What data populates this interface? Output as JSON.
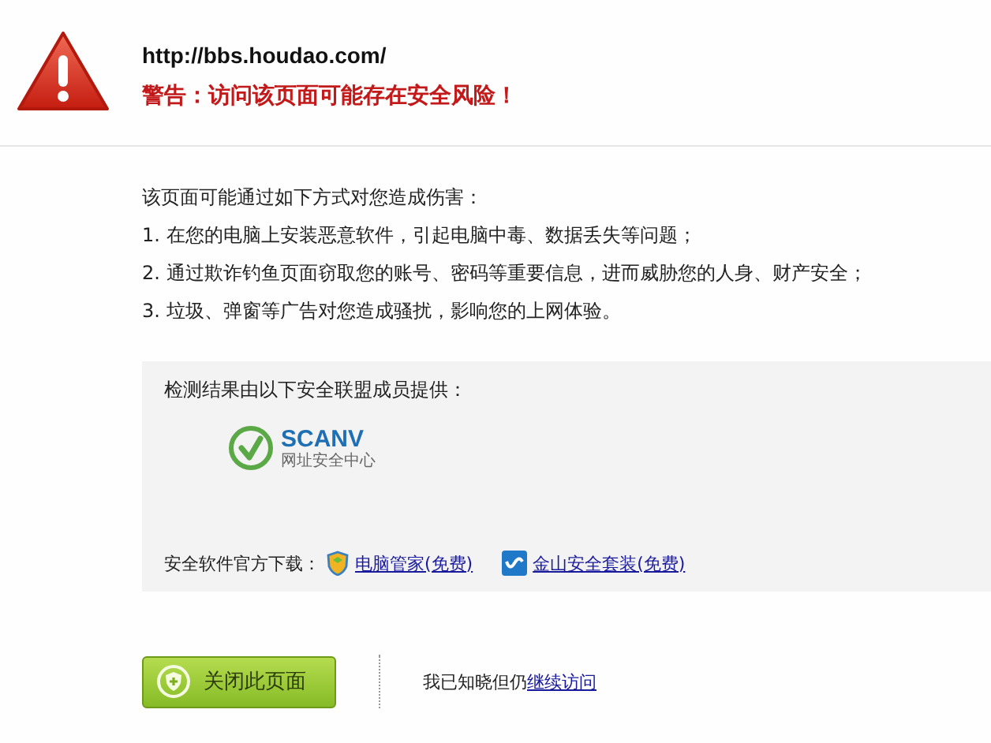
{
  "header": {
    "url": "http://bbs.houdao.com/",
    "warning": "警告：访问该页面可能存在安全风险！"
  },
  "risks": {
    "intro": "该页面可能通过如下方式对您造成伤害：",
    "items": [
      "1. 在您的电脑上安装恶意软件，引起电脑中毒、数据丢失等问题；",
      "2. 通过欺诈钓鱼页面窃取您的账号、密码等重要信息，进而威胁您的人身、财产安全；",
      "3. 垃圾、弹窗等广告对您造成骚扰，影响您的上网体验。"
    ]
  },
  "provider": {
    "caption": "检测结果由以下安全联盟成员提供：",
    "logo_name": "SCANV",
    "logo_subtitle": "网址安全中心",
    "download_label": "安全软件官方下载：",
    "downloads": [
      {
        "kind": "shield",
        "label": "电脑管家(免费)"
      },
      {
        "kind": "kingsoft",
        "label": "金山安全套装(免费)"
      }
    ]
  },
  "actions": {
    "close_button": "关闭此页面",
    "continue_text": "我已知晓但仍",
    "continue_link": "继续访问"
  }
}
